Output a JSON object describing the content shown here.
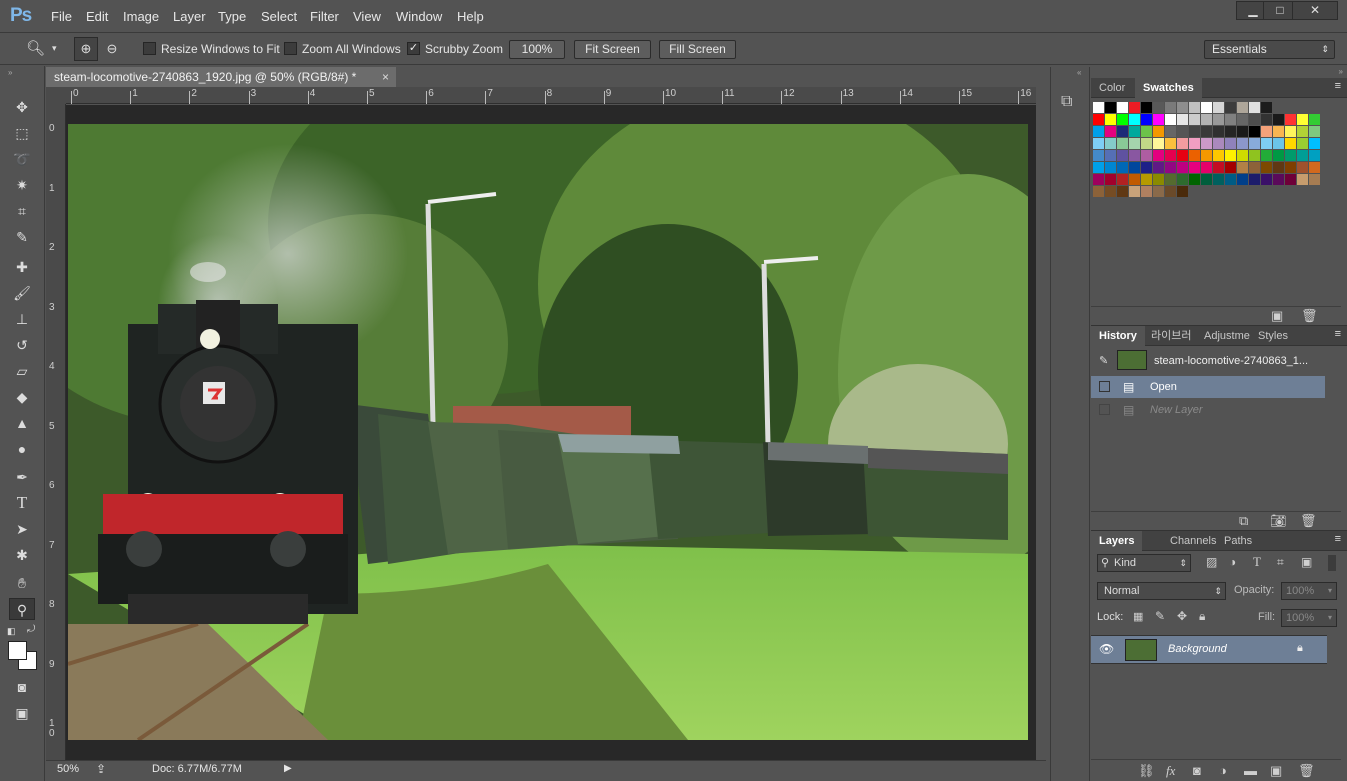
{
  "app": {
    "logo": "Ps"
  },
  "menu": [
    "File",
    "Edit",
    "Image",
    "Layer",
    "Type",
    "Select",
    "Filter",
    "View",
    "Window",
    "Help"
  ],
  "window_controls": {
    "minimize": "▁",
    "maximize": "□",
    "close": "✕"
  },
  "options": {
    "resize_windows": "Resize Windows to Fit",
    "zoom_all": "Zoom All Windows",
    "scrubby_zoom": "Scrubby Zoom",
    "zoom_100": "100%",
    "fit_screen": "Fit Screen",
    "fill_screen": "Fill Screen",
    "workspace": "Essentials"
  },
  "document": {
    "tab_title": "steam-locomotive-2740863_1920.jpg @ 50% (RGB/8#) *",
    "close": "×",
    "ruler_h": [
      "0",
      "1",
      "2",
      "3",
      "4",
      "5",
      "6",
      "7",
      "8",
      "9",
      "10",
      "11",
      "12",
      "13",
      "14",
      "15",
      "16"
    ],
    "ruler_v": [
      "0",
      "1",
      "2",
      "3",
      "4",
      "5",
      "6",
      "7",
      "8",
      "9",
      "1 0"
    ]
  },
  "status": {
    "zoom": "50%",
    "doc": "Doc: 6.77M/6.77M"
  },
  "swatches_panel": {
    "tabs": [
      "Color",
      "Swatches"
    ],
    "colors": [
      [
        "#ffffff",
        "#000000",
        "#ffffff",
        "#ed1c24",
        "#000000",
        "#595959",
        "#7a7a7a",
        "#8e8e8e",
        "#c0c0c0",
        "#ffffff",
        "#d6d6d6",
        "#3c3c3c",
        "#aea69a",
        "#e0e0e0",
        "#1c1c1c"
      ],
      [
        "#ff0000",
        "#ffff00",
        "#00ff00",
        "#00ffff",
        "#0000ff",
        "#ff00ff",
        "#ffffff",
        "#e6e6e6",
        "#cccccc",
        "#b3b3b3",
        "#999999",
        "#808080",
        "#666666",
        "#4d4d4d",
        "#333333",
        "#1a1a1a",
        "#ff3333",
        "#ffff33",
        "#33cc33"
      ],
      [
        "#00a0e9",
        "#e4007f",
        "#1e2a78",
        "#00a99d",
        "#6cc24a",
        "#f39800",
        "#666666",
        "#555555",
        "#444444",
        "#3a3a3a",
        "#303030",
        "#252525",
        "#1a1a1a",
        "#000000",
        "#f5a27a",
        "#f8b551",
        "#fff45c",
        "#b2d235",
        "#7fc97f"
      ],
      [
        "#7ecef4",
        "#84ccc9",
        "#89c997",
        "#a5d4ad",
        "#c2d887",
        "#fff799",
        "#fac03d",
        "#f29c9f",
        "#f19ec2",
        "#cc99c9",
        "#aa89bd",
        "#8f82bc",
        "#8c97cb",
        "#88abda",
        "#7ecef4",
        "#6bc4e8",
        "#ffd700",
        "#9acd32",
        "#00bfff"
      ],
      [
        "#448aca",
        "#556fb5",
        "#5f52a0",
        "#8957a1",
        "#ae5da1",
        "#e4007f",
        "#e5004f",
        "#e60012",
        "#eb6100",
        "#f39800",
        "#fcc800",
        "#fff100",
        "#cfdb00",
        "#8fc31f",
        "#22ac38",
        "#009944",
        "#009b6b",
        "#009e96",
        "#00a0c1"
      ],
      [
        "#00a0e9",
        "#0086d1",
        "#0068b7",
        "#00479d",
        "#1d2088",
        "#601986",
        "#920783",
        "#be0081",
        "#e5007f",
        "#e5006a",
        "#c30d23",
        "#a40000",
        "#b28146",
        "#8c6239",
        "#7d4900",
        "#603813",
        "#7f3f00",
        "#a0522d",
        "#d2691e"
      ],
      [
        "#9e005d",
        "#a2002c",
        "#b22222",
        "#c05a00",
        "#b59a00",
        "#8a8a00",
        "#556b2f",
        "#2e6b2e",
        "#006400",
        "#005e3c",
        "#00605e",
        "#005c85",
        "#003f8a",
        "#1c1c6b",
        "#3a1068",
        "#5a0a5a",
        "#6e0038",
        "#c69c6d",
        "#a67c52"
      ],
      [
        "#8c6239",
        "#754c24",
        "#603813",
        "#c8a27a",
        "#b08060",
        "#8a6a4a",
        "#6a4a2a",
        "#4a2a0a"
      ]
    ]
  },
  "history_panel": {
    "tabs": [
      "History",
      "라이브러",
      "Adjustme",
      "Styles"
    ],
    "snapshot": "steam-locomotive-2740863_1...",
    "items": [
      "Open",
      "New Layer"
    ]
  },
  "layers_panel": {
    "tabs": [
      "Layers",
      "Channels",
      "Paths"
    ],
    "kind": "Kind",
    "blend": "Normal",
    "opacity_label": "Opacity:",
    "opacity": "100%",
    "lock_label": "Lock:",
    "fill_label": "Fill:",
    "fill": "100%",
    "layers": [
      {
        "name": "Background"
      }
    ]
  }
}
